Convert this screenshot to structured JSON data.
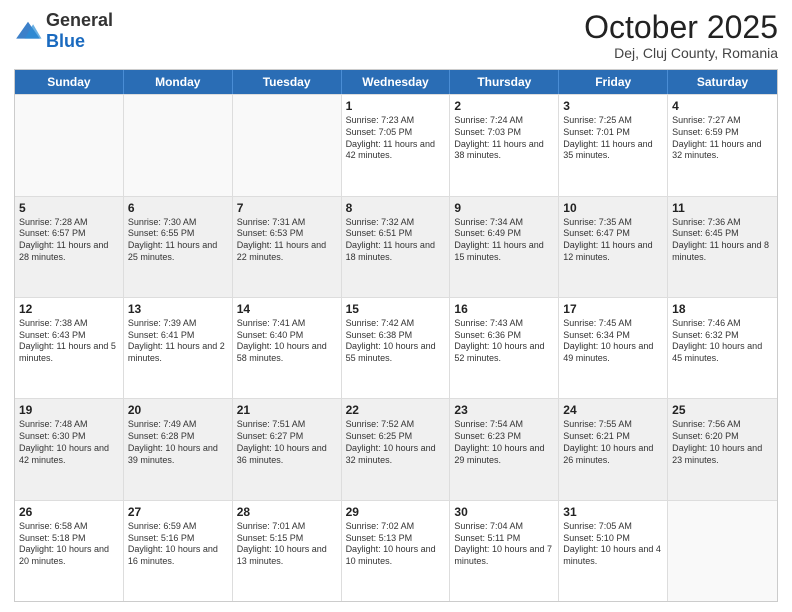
{
  "header": {
    "logo_general": "General",
    "logo_blue": "Blue",
    "month": "October 2025",
    "location": "Dej, Cluj County, Romania"
  },
  "weekdays": [
    "Sunday",
    "Monday",
    "Tuesday",
    "Wednesday",
    "Thursday",
    "Friday",
    "Saturday"
  ],
  "rows": [
    [
      {
        "day": "",
        "info": ""
      },
      {
        "day": "",
        "info": ""
      },
      {
        "day": "",
        "info": ""
      },
      {
        "day": "1",
        "info": "Sunrise: 7:23 AM\nSunset: 7:05 PM\nDaylight: 11 hours and 42 minutes."
      },
      {
        "day": "2",
        "info": "Sunrise: 7:24 AM\nSunset: 7:03 PM\nDaylight: 11 hours and 38 minutes."
      },
      {
        "day": "3",
        "info": "Sunrise: 7:25 AM\nSunset: 7:01 PM\nDaylight: 11 hours and 35 minutes."
      },
      {
        "day": "4",
        "info": "Sunrise: 7:27 AM\nSunset: 6:59 PM\nDaylight: 11 hours and 32 minutes."
      }
    ],
    [
      {
        "day": "5",
        "info": "Sunrise: 7:28 AM\nSunset: 6:57 PM\nDaylight: 11 hours and 28 minutes."
      },
      {
        "day": "6",
        "info": "Sunrise: 7:30 AM\nSunset: 6:55 PM\nDaylight: 11 hours and 25 minutes."
      },
      {
        "day": "7",
        "info": "Sunrise: 7:31 AM\nSunset: 6:53 PM\nDaylight: 11 hours and 22 minutes."
      },
      {
        "day": "8",
        "info": "Sunrise: 7:32 AM\nSunset: 6:51 PM\nDaylight: 11 hours and 18 minutes."
      },
      {
        "day": "9",
        "info": "Sunrise: 7:34 AM\nSunset: 6:49 PM\nDaylight: 11 hours and 15 minutes."
      },
      {
        "day": "10",
        "info": "Sunrise: 7:35 AM\nSunset: 6:47 PM\nDaylight: 11 hours and 12 minutes."
      },
      {
        "day": "11",
        "info": "Sunrise: 7:36 AM\nSunset: 6:45 PM\nDaylight: 11 hours and 8 minutes."
      }
    ],
    [
      {
        "day": "12",
        "info": "Sunrise: 7:38 AM\nSunset: 6:43 PM\nDaylight: 11 hours and 5 minutes."
      },
      {
        "day": "13",
        "info": "Sunrise: 7:39 AM\nSunset: 6:41 PM\nDaylight: 11 hours and 2 minutes."
      },
      {
        "day": "14",
        "info": "Sunrise: 7:41 AM\nSunset: 6:40 PM\nDaylight: 10 hours and 58 minutes."
      },
      {
        "day": "15",
        "info": "Sunrise: 7:42 AM\nSunset: 6:38 PM\nDaylight: 10 hours and 55 minutes."
      },
      {
        "day": "16",
        "info": "Sunrise: 7:43 AM\nSunset: 6:36 PM\nDaylight: 10 hours and 52 minutes."
      },
      {
        "day": "17",
        "info": "Sunrise: 7:45 AM\nSunset: 6:34 PM\nDaylight: 10 hours and 49 minutes."
      },
      {
        "day": "18",
        "info": "Sunrise: 7:46 AM\nSunset: 6:32 PM\nDaylight: 10 hours and 45 minutes."
      }
    ],
    [
      {
        "day": "19",
        "info": "Sunrise: 7:48 AM\nSunset: 6:30 PM\nDaylight: 10 hours and 42 minutes."
      },
      {
        "day": "20",
        "info": "Sunrise: 7:49 AM\nSunset: 6:28 PM\nDaylight: 10 hours and 39 minutes."
      },
      {
        "day": "21",
        "info": "Sunrise: 7:51 AM\nSunset: 6:27 PM\nDaylight: 10 hours and 36 minutes."
      },
      {
        "day": "22",
        "info": "Sunrise: 7:52 AM\nSunset: 6:25 PM\nDaylight: 10 hours and 32 minutes."
      },
      {
        "day": "23",
        "info": "Sunrise: 7:54 AM\nSunset: 6:23 PM\nDaylight: 10 hours and 29 minutes."
      },
      {
        "day": "24",
        "info": "Sunrise: 7:55 AM\nSunset: 6:21 PM\nDaylight: 10 hours and 26 minutes."
      },
      {
        "day": "25",
        "info": "Sunrise: 7:56 AM\nSunset: 6:20 PM\nDaylight: 10 hours and 23 minutes."
      }
    ],
    [
      {
        "day": "26",
        "info": "Sunrise: 6:58 AM\nSunset: 5:18 PM\nDaylight: 10 hours and 20 minutes."
      },
      {
        "day": "27",
        "info": "Sunrise: 6:59 AM\nSunset: 5:16 PM\nDaylight: 10 hours and 16 minutes."
      },
      {
        "day": "28",
        "info": "Sunrise: 7:01 AM\nSunset: 5:15 PM\nDaylight: 10 hours and 13 minutes."
      },
      {
        "day": "29",
        "info": "Sunrise: 7:02 AM\nSunset: 5:13 PM\nDaylight: 10 hours and 10 minutes."
      },
      {
        "day": "30",
        "info": "Sunrise: 7:04 AM\nSunset: 5:11 PM\nDaylight: 10 hours and 7 minutes."
      },
      {
        "day": "31",
        "info": "Sunrise: 7:05 AM\nSunset: 5:10 PM\nDaylight: 10 hours and 4 minutes."
      },
      {
        "day": "",
        "info": ""
      }
    ]
  ],
  "shaded_rows": [
    1,
    3
  ],
  "colors": {
    "header_bg": "#2a6db5",
    "header_text": "#ffffff",
    "shaded_bg": "#f0f0f0",
    "empty_bg": "#f9f9f9"
  }
}
